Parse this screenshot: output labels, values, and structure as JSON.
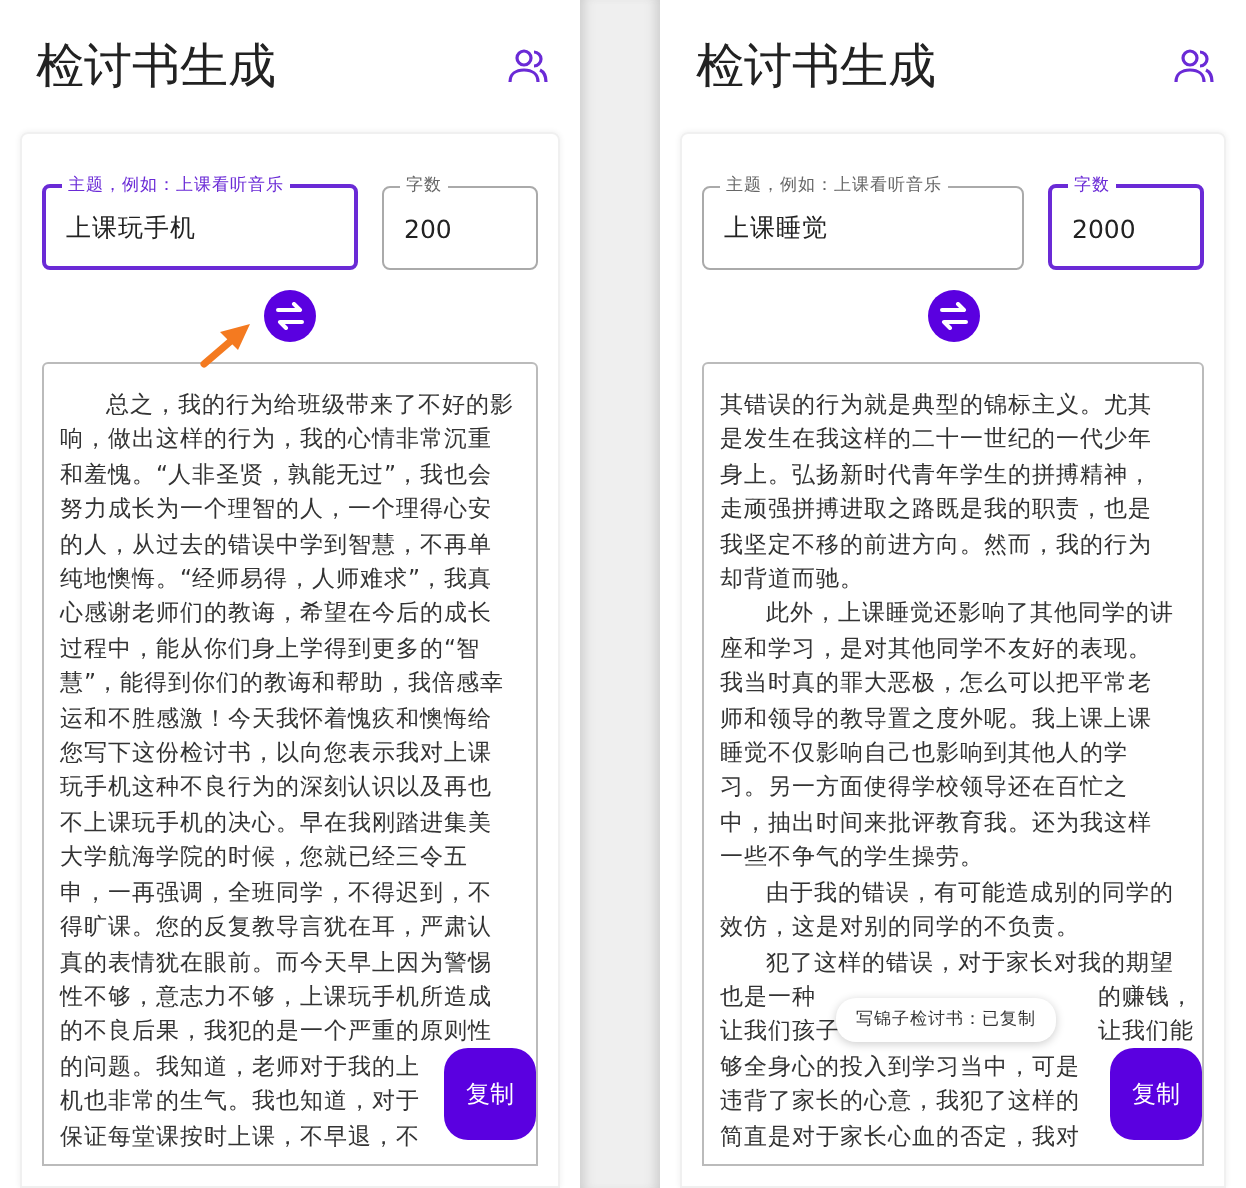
{
  "phones": [
    {
      "title": "检讨书生成",
      "topic": {
        "label": "主题，例如：上课看听音乐",
        "value": "上课玩手机",
        "focused": true
      },
      "count": {
        "label": "字数",
        "value": "200",
        "focused": false
      },
      "copy_button": "复制",
      "lines": [
        {
          "text": "总之，我的行为给班级带来了不好的影",
          "indent": true
        },
        {
          "text": "响，做出这样的行为，我的心情非常沉重",
          "indent": false
        },
        {
          "text": "和羞愧。“人非圣贤，孰能无过”，我也会",
          "indent": false
        },
        {
          "text": "努力成长为一个理智的人，一个理得心安",
          "indent": false
        },
        {
          "text": "的人，从过去的错误中学到智慧，不再单",
          "indent": false
        },
        {
          "text": "纯地懊悔。“经师易得，人师难求”，我真",
          "indent": false
        },
        {
          "text": "心感谢老师们的教诲，希望在今后的成长",
          "indent": false
        },
        {
          "text": "过程中，能从你们身上学得到更多的“智",
          "indent": false
        },
        {
          "text": "慧”，能得到你们的教诲和帮助，我倍感幸",
          "indent": false
        },
        {
          "text": "运和不胜感激！今天我怀着愧疚和懊悔给",
          "indent": false
        },
        {
          "text": "您写下这份检讨书，以向您表示我对上课",
          "indent": false
        },
        {
          "text": "玩手机这种不良行为的深刻认识以及再也",
          "indent": false
        },
        {
          "text": "不上课玩手机的决心。早在我刚踏进集美",
          "indent": false
        },
        {
          "text": "大学航海学院的时候，您就已经三令五",
          "indent": false
        },
        {
          "text": "申，一再强调，全班同学，不得迟到，不",
          "indent": false
        },
        {
          "text": "得旷课。您的反复教导言犹在耳，严肃认",
          "indent": false
        },
        {
          "text": "真的表情犹在眼前。而今天早上因为警惕",
          "indent": false
        },
        {
          "text": "性不够，意志力不够，上课玩手机所造成",
          "indent": false
        },
        {
          "text": "的不良后果，我犯的是一个严重的原则性",
          "indent": false
        },
        {
          "text": "的问题。我知道，老师对于我的上",
          "indent": false
        },
        {
          "text": "机也非常的生气。我也知道，对于",
          "indent": false
        },
        {
          "text": "保证每堂课按时上课，不早退，不",
          "indent": false
        }
      ]
    },
    {
      "title": "检讨书生成",
      "topic": {
        "label": "主题，例如：上课看听音乐",
        "value": "上课睡觉",
        "focused": false
      },
      "count": {
        "label": "字数",
        "value": "2000",
        "focused": true
      },
      "copy_button": "复制",
      "toast": "写锦子检讨书：已复制",
      "lines": [
        {
          "text": "其错误的行为就是典型的锦标主义。尤其",
          "indent": false
        },
        {
          "text": "是发生在我这样的二十一世纪的一代少年",
          "indent": false
        },
        {
          "text": "身上。弘扬新时代青年学生的拼搏精神，",
          "indent": false
        },
        {
          "text": "走顽强拼搏进取之路既是我的职责，也是",
          "indent": false
        },
        {
          "text": "我坚定不移的前进方向。然而，我的行为",
          "indent": false
        },
        {
          "text": "却背道而驰。",
          "indent": false
        },
        {
          "text": "此外，上课睡觉还影响了其他同学的讲",
          "indent": true
        },
        {
          "text": "座和学习，是对其他同学不友好的表现。",
          "indent": false
        },
        {
          "text": "我当时真的罪大恶极，怎么可以把平常老",
          "indent": false
        },
        {
          "text": "师和领导的教导置之度外呢。我上课上课",
          "indent": false
        },
        {
          "text": "睡觉不仅影响自己也影响到其他人的学",
          "indent": false
        },
        {
          "text": "习。另一方面使得学校领导还在百忙之",
          "indent": false
        },
        {
          "text": "中，抽出时间来批评教育我。还为我这样",
          "indent": false
        },
        {
          "text": "一些不争气的学生操劳。",
          "indent": false
        },
        {
          "text": "由于我的错误，有可能造成别的同学的",
          "indent": true
        },
        {
          "text": "效仿，这是对别的同学的不负责。",
          "indent": false
        },
        {
          "text": "犯了这样的错误，对于家长对我的期望",
          "indent": true
        },
        {
          "text": "也是一种",
          "tail": "的赚钱，",
          "indent": false
        },
        {
          "text": "让我们孩子",
          "tail": "让我们能",
          "indent": false
        },
        {
          "text": "够全身心的投入到学习当中，可是",
          "indent": false
        },
        {
          "text": "违背了家长的心意，我犯了这样的",
          "indent": false
        },
        {
          "text": "简直是对于家长心血的否定，我对",
          "indent": false
        }
      ]
    }
  ]
}
